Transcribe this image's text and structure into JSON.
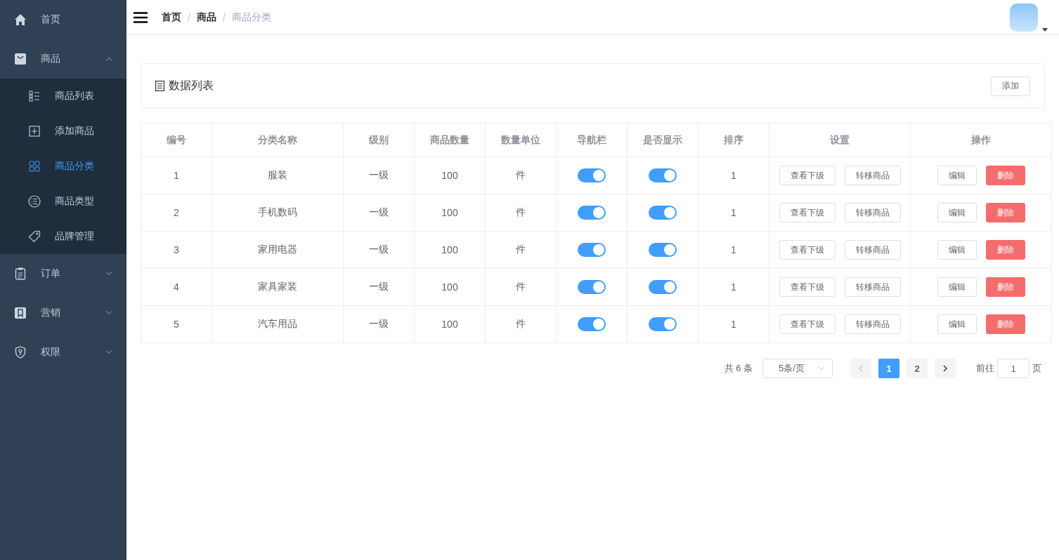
{
  "sidebar": {
    "items": [
      {
        "label": "首页",
        "kind": "link",
        "selected": false
      },
      {
        "label": "商品",
        "kind": "submenu",
        "expanded": true,
        "selected": false,
        "children": [
          {
            "label": "商品列表",
            "selected": false
          },
          {
            "label": "添加商品",
            "selected": false
          },
          {
            "label": "商品分类",
            "selected": true
          },
          {
            "label": "商品类型",
            "selected": false
          },
          {
            "label": "品牌管理",
            "selected": false
          }
        ]
      },
      {
        "label": "订单",
        "kind": "submenu",
        "expanded": false,
        "selected": false
      },
      {
        "label": "营销",
        "kind": "submenu",
        "expanded": false,
        "selected": false
      },
      {
        "label": "权限",
        "kind": "submenu",
        "expanded": false,
        "selected": false
      }
    ]
  },
  "breadcrumb": {
    "items": [
      {
        "label": "首页",
        "current": false
      },
      {
        "label": "商品",
        "current": false
      },
      {
        "label": "商品分类",
        "current": true
      }
    ],
    "separators": [
      "/",
      "/"
    ]
  },
  "card": {
    "title": "数据列表",
    "add_button": "添加"
  },
  "table": {
    "columns": [
      "编号",
      "分类名称",
      "级别",
      "商品数量",
      "数量单位",
      "导航栏",
      "是否显示",
      "排序",
      "设置",
      "操作"
    ],
    "rows": [
      {
        "id": "1",
        "name": "服装",
        "level": "一级",
        "count": "100",
        "unit": "件",
        "nav_on": true,
        "show_on": true,
        "sort": "1",
        "actions": [
          "查看下级",
          "转移商品",
          "编辑",
          "删除"
        ]
      },
      {
        "id": "2",
        "name": "手机数码",
        "level": "一级",
        "count": "100",
        "unit": "件",
        "nav_on": true,
        "show_on": true,
        "sort": "1",
        "actions": [
          "查看下级",
          "转移商品",
          "编辑",
          "删除"
        ]
      },
      {
        "id": "3",
        "name": "家用电器",
        "level": "一级",
        "count": "100",
        "unit": "件",
        "nav_on": true,
        "show_on": true,
        "sort": "1",
        "actions": [
          "查看下级",
          "转移商品",
          "编辑",
          "删除"
        ]
      },
      {
        "id": "4",
        "name": "家具家装",
        "level": "一级",
        "count": "100",
        "unit": "件",
        "nav_on": true,
        "show_on": true,
        "sort": "1",
        "actions": [
          "查看下级",
          "转移商品",
          "编辑",
          "删除"
        ]
      },
      {
        "id": "5",
        "name": "汽车用品",
        "level": "一级",
        "count": "100",
        "unit": "件",
        "nav_on": true,
        "show_on": true,
        "sort": "1",
        "actions": [
          "查看下级",
          "转移商品",
          "编辑",
          "删除"
        ]
      }
    ]
  },
  "pagination": {
    "total": "共 6 条",
    "page_size": "5条/页",
    "pages": [
      {
        "label": "1",
        "selected": true
      },
      {
        "label": "2",
        "selected": false
      }
    ],
    "jump_label": "前往",
    "jump_value": "1",
    "jump_suffix": "页"
  }
}
